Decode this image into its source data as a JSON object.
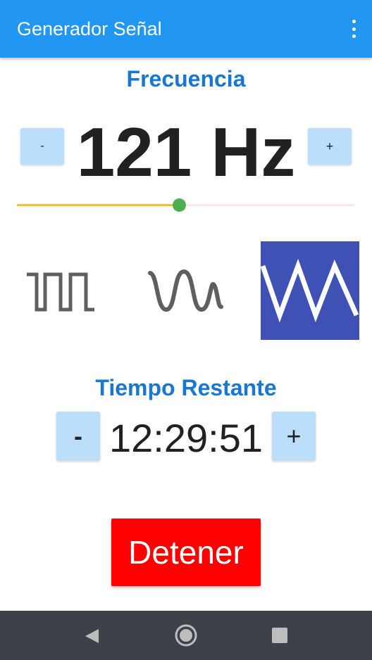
{
  "app": {
    "title": "Generador Señal",
    "menu_icon": "more-vert-icon"
  },
  "frequency": {
    "heading": "Frecuencia",
    "value": "121 Hz",
    "decrement_label": "-",
    "increment_label": "+",
    "slider_fraction": 0.48
  },
  "waveforms": [
    {
      "name": "square",
      "icon": "square-wave-icon",
      "selected": false
    },
    {
      "name": "sine",
      "icon": "sine-wave-icon",
      "selected": false
    },
    {
      "name": "triangle",
      "icon": "triangle-wave-icon",
      "selected": true
    }
  ],
  "timer": {
    "heading": "Tiempo Restante",
    "value": "12:29:51",
    "decrement_label": "-",
    "increment_label": "+"
  },
  "stop_button": {
    "label": "Detener"
  },
  "colors": {
    "accent": "#2196f3",
    "heading": "#1976d2",
    "stop": "#ff0000",
    "selected_wave": "#3f51b5"
  }
}
